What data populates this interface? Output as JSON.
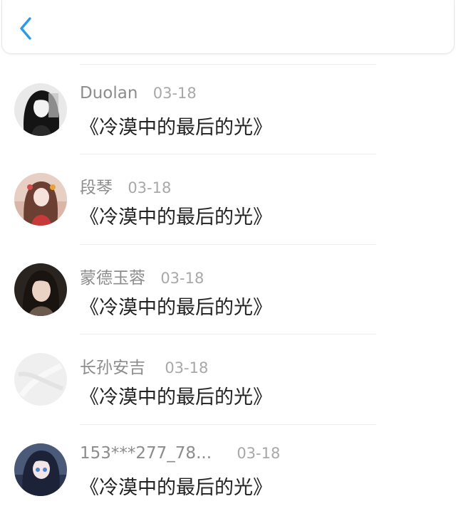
{
  "header": {
    "back_icon": "chevron-left-icon",
    "accent": "#2f9ae4"
  },
  "items": [
    {
      "name": "Duolan",
      "date": "03-18",
      "title": "《冷漠中的最后的光》",
      "avatar": "dark-hair-girl-avatar"
    },
    {
      "name": "段琴",
      "date": "03-18",
      "title": "《冷漠中的最后的光》",
      "avatar": "painted-girl-avatar"
    },
    {
      "name": "蒙德玉蓉",
      "date": "03-18",
      "title": "《冷漠中的最后的光》",
      "avatar": "photo-girl-avatar"
    },
    {
      "name": "长孙安吉",
      "date": "03-18",
      "title": "《冷漠中的最后的光》",
      "avatar": "blank-gray-avatar"
    },
    {
      "name": "153***277_78...",
      "date": "03-18",
      "title": "《冷漠中的最后的光》",
      "avatar": "anime-girl-avatar"
    }
  ]
}
